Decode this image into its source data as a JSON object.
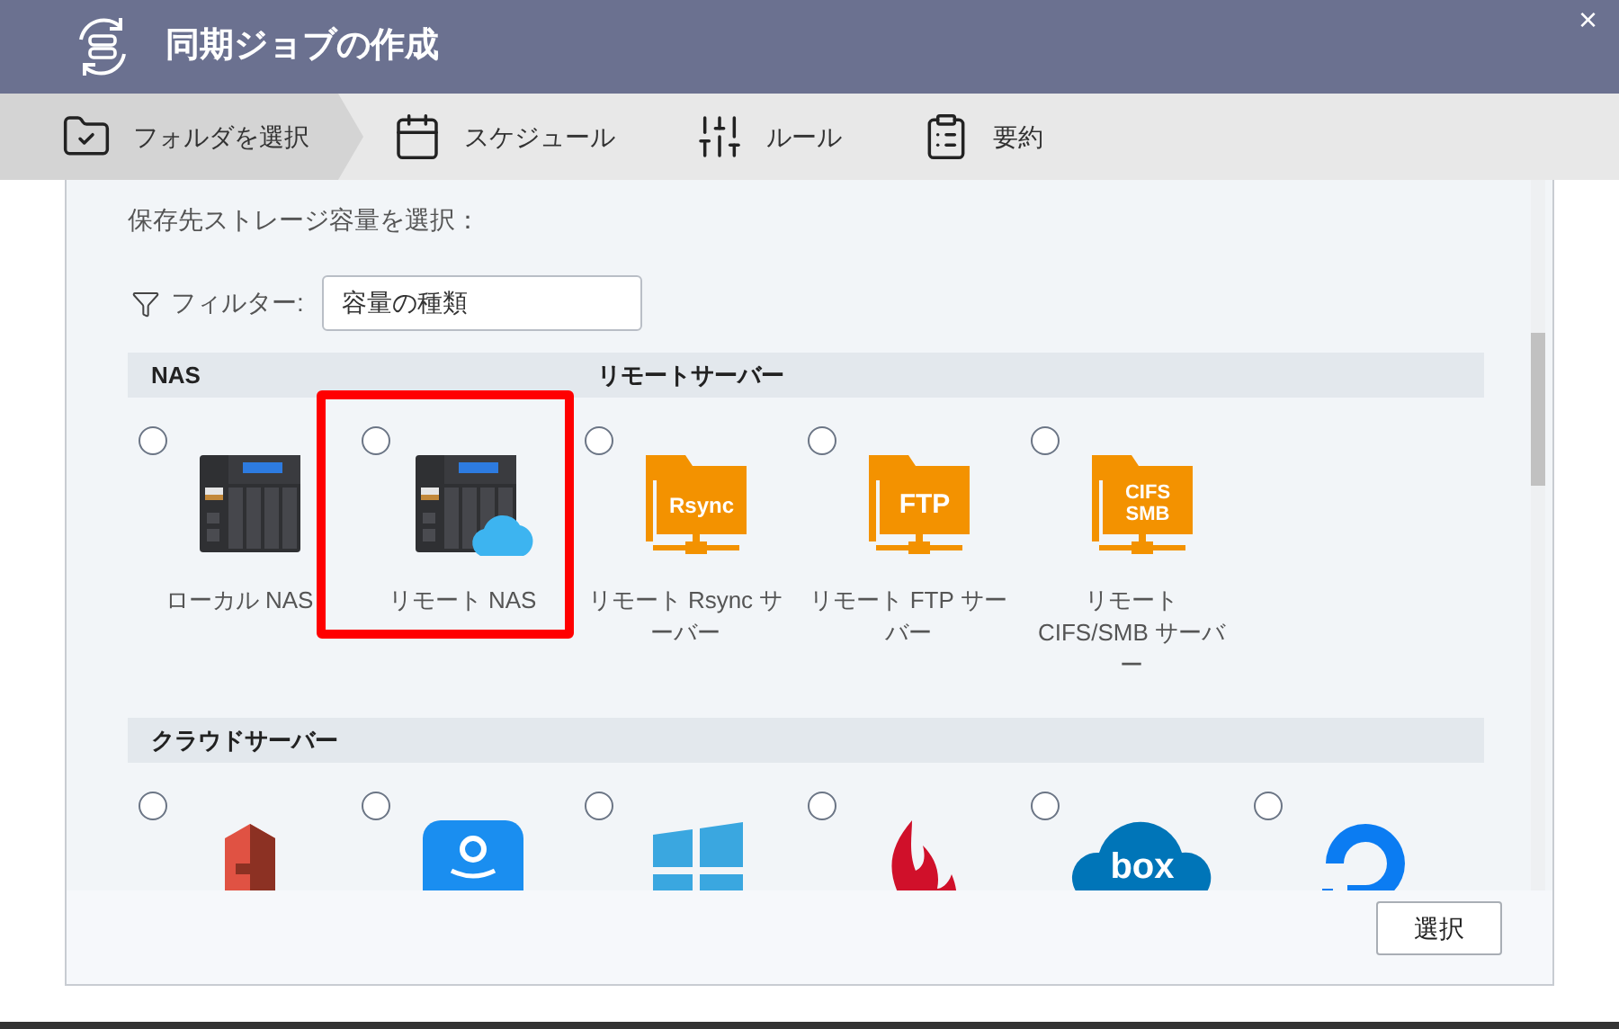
{
  "window": {
    "title": "同期ジョブの作成",
    "close": "×"
  },
  "steps": [
    {
      "label": "フォルダを選択",
      "kind": "folder",
      "selected": true
    },
    {
      "label": "スケジュール",
      "kind": "calendar",
      "selected": false
    },
    {
      "label": "ルール",
      "kind": "rules",
      "selected": false
    },
    {
      "label": "要約",
      "kind": "summary",
      "selected": false
    }
  ],
  "prompt": "保存先ストレージ容量を選択：",
  "filter": {
    "label": "フィルター:",
    "value": "容量の種類"
  },
  "sections": [
    {
      "headings": [
        "NAS",
        "リモートサーバー"
      ],
      "items": [
        {
          "label": "ローカル NAS",
          "kind": "nas",
          "selected": false,
          "highlighted": false
        },
        {
          "label": "リモート NAS",
          "kind": "nas-cloud",
          "selected": false,
          "highlighted": true
        },
        {
          "label": "リモート Rsync サーバー",
          "kind": "folder-server",
          "icon_text": [
            "Rsync"
          ],
          "selected": false,
          "highlighted": false
        },
        {
          "label": "リモート FTP サーバー",
          "kind": "folder-server",
          "icon_text": [
            "FTP"
          ],
          "selected": false,
          "highlighted": false
        },
        {
          "label": "リモート CIFS/SMB サーバー",
          "kind": "folder-server",
          "icon_text": [
            "CIFS",
            "SMB"
          ],
          "selected": false,
          "highlighted": false
        }
      ]
    },
    {
      "headings": [
        "クラウドサーバー"
      ],
      "items": [
        {
          "kind": "s3",
          "selected": false,
          "highlighted": false
        },
        {
          "kind": "amazon-drive",
          "selected": false,
          "highlighted": false
        },
        {
          "kind": "azure",
          "selected": false,
          "highlighted": false
        },
        {
          "kind": "backblaze",
          "selected": false,
          "highlighted": false
        },
        {
          "kind": "box",
          "icon_text": [
            "box"
          ],
          "selected": false,
          "highlighted": false
        },
        {
          "kind": "digitalocean",
          "selected": false,
          "highlighted": false
        }
      ]
    }
  ],
  "buttons": [
    "選択"
  ]
}
